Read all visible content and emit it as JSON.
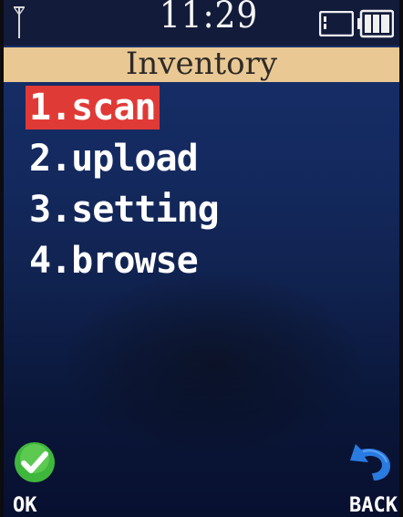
{
  "status_bar": {
    "time": "11:29",
    "signal_icon": "signal-antenna-icon",
    "sd_icon": "sd-card-icon",
    "battery_icon": "battery-full-icon"
  },
  "title": "Inventory",
  "menu": {
    "items": [
      {
        "label": "1.scan",
        "selected": true
      },
      {
        "label": "2.upload",
        "selected": false
      },
      {
        "label": "3.setting",
        "selected": false
      },
      {
        "label": "4.browse",
        "selected": false
      }
    ]
  },
  "softkeys": {
    "left": {
      "label": "OK",
      "icon": "green-check-icon"
    },
    "right": {
      "label": "BACK",
      "icon": "blue-back-arrow-icon"
    }
  },
  "colors": {
    "title_bar": "#e9c894",
    "selection": "#e03a36",
    "screen_bg": "#142a60"
  }
}
